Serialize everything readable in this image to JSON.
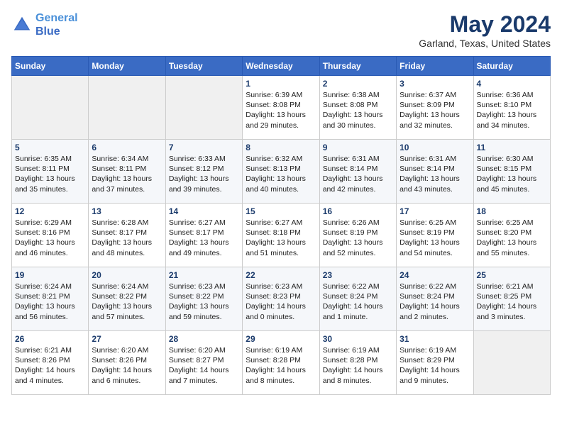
{
  "logo": {
    "line1": "General",
    "line2": "Blue"
  },
  "title": "May 2024",
  "subtitle": "Garland, Texas, United States",
  "days_of_week": [
    "Sunday",
    "Monday",
    "Tuesday",
    "Wednesday",
    "Thursday",
    "Friday",
    "Saturday"
  ],
  "weeks": [
    [
      {
        "day": "",
        "info": ""
      },
      {
        "day": "",
        "info": ""
      },
      {
        "day": "",
        "info": ""
      },
      {
        "day": "1",
        "info": "Sunrise: 6:39 AM\nSunset: 8:08 PM\nDaylight: 13 hours\nand 29 minutes."
      },
      {
        "day": "2",
        "info": "Sunrise: 6:38 AM\nSunset: 8:08 PM\nDaylight: 13 hours\nand 30 minutes."
      },
      {
        "day": "3",
        "info": "Sunrise: 6:37 AM\nSunset: 8:09 PM\nDaylight: 13 hours\nand 32 minutes."
      },
      {
        "day": "4",
        "info": "Sunrise: 6:36 AM\nSunset: 8:10 PM\nDaylight: 13 hours\nand 34 minutes."
      }
    ],
    [
      {
        "day": "5",
        "info": "Sunrise: 6:35 AM\nSunset: 8:11 PM\nDaylight: 13 hours\nand 35 minutes."
      },
      {
        "day": "6",
        "info": "Sunrise: 6:34 AM\nSunset: 8:11 PM\nDaylight: 13 hours\nand 37 minutes."
      },
      {
        "day": "7",
        "info": "Sunrise: 6:33 AM\nSunset: 8:12 PM\nDaylight: 13 hours\nand 39 minutes."
      },
      {
        "day": "8",
        "info": "Sunrise: 6:32 AM\nSunset: 8:13 PM\nDaylight: 13 hours\nand 40 minutes."
      },
      {
        "day": "9",
        "info": "Sunrise: 6:31 AM\nSunset: 8:14 PM\nDaylight: 13 hours\nand 42 minutes."
      },
      {
        "day": "10",
        "info": "Sunrise: 6:31 AM\nSunset: 8:14 PM\nDaylight: 13 hours\nand 43 minutes."
      },
      {
        "day": "11",
        "info": "Sunrise: 6:30 AM\nSunset: 8:15 PM\nDaylight: 13 hours\nand 45 minutes."
      }
    ],
    [
      {
        "day": "12",
        "info": "Sunrise: 6:29 AM\nSunset: 8:16 PM\nDaylight: 13 hours\nand 46 minutes."
      },
      {
        "day": "13",
        "info": "Sunrise: 6:28 AM\nSunset: 8:17 PM\nDaylight: 13 hours\nand 48 minutes."
      },
      {
        "day": "14",
        "info": "Sunrise: 6:27 AM\nSunset: 8:17 PM\nDaylight: 13 hours\nand 49 minutes."
      },
      {
        "day": "15",
        "info": "Sunrise: 6:27 AM\nSunset: 8:18 PM\nDaylight: 13 hours\nand 51 minutes."
      },
      {
        "day": "16",
        "info": "Sunrise: 6:26 AM\nSunset: 8:19 PM\nDaylight: 13 hours\nand 52 minutes."
      },
      {
        "day": "17",
        "info": "Sunrise: 6:25 AM\nSunset: 8:19 PM\nDaylight: 13 hours\nand 54 minutes."
      },
      {
        "day": "18",
        "info": "Sunrise: 6:25 AM\nSunset: 8:20 PM\nDaylight: 13 hours\nand 55 minutes."
      }
    ],
    [
      {
        "day": "19",
        "info": "Sunrise: 6:24 AM\nSunset: 8:21 PM\nDaylight: 13 hours\nand 56 minutes."
      },
      {
        "day": "20",
        "info": "Sunrise: 6:24 AM\nSunset: 8:22 PM\nDaylight: 13 hours\nand 57 minutes."
      },
      {
        "day": "21",
        "info": "Sunrise: 6:23 AM\nSunset: 8:22 PM\nDaylight: 13 hours\nand 59 minutes."
      },
      {
        "day": "22",
        "info": "Sunrise: 6:23 AM\nSunset: 8:23 PM\nDaylight: 14 hours\nand 0 minutes."
      },
      {
        "day": "23",
        "info": "Sunrise: 6:22 AM\nSunset: 8:24 PM\nDaylight: 14 hours\nand 1 minute."
      },
      {
        "day": "24",
        "info": "Sunrise: 6:22 AM\nSunset: 8:24 PM\nDaylight: 14 hours\nand 2 minutes."
      },
      {
        "day": "25",
        "info": "Sunrise: 6:21 AM\nSunset: 8:25 PM\nDaylight: 14 hours\nand 3 minutes."
      }
    ],
    [
      {
        "day": "26",
        "info": "Sunrise: 6:21 AM\nSunset: 8:26 PM\nDaylight: 14 hours\nand 4 minutes."
      },
      {
        "day": "27",
        "info": "Sunrise: 6:20 AM\nSunset: 8:26 PM\nDaylight: 14 hours\nand 6 minutes."
      },
      {
        "day": "28",
        "info": "Sunrise: 6:20 AM\nSunset: 8:27 PM\nDaylight: 14 hours\nand 7 minutes."
      },
      {
        "day": "29",
        "info": "Sunrise: 6:19 AM\nSunset: 8:28 PM\nDaylight: 14 hours\nand 8 minutes."
      },
      {
        "day": "30",
        "info": "Sunrise: 6:19 AM\nSunset: 8:28 PM\nDaylight: 14 hours\nand 8 minutes."
      },
      {
        "day": "31",
        "info": "Sunrise: 6:19 AM\nSunset: 8:29 PM\nDaylight: 14 hours\nand 9 minutes."
      },
      {
        "day": "",
        "info": ""
      }
    ]
  ]
}
